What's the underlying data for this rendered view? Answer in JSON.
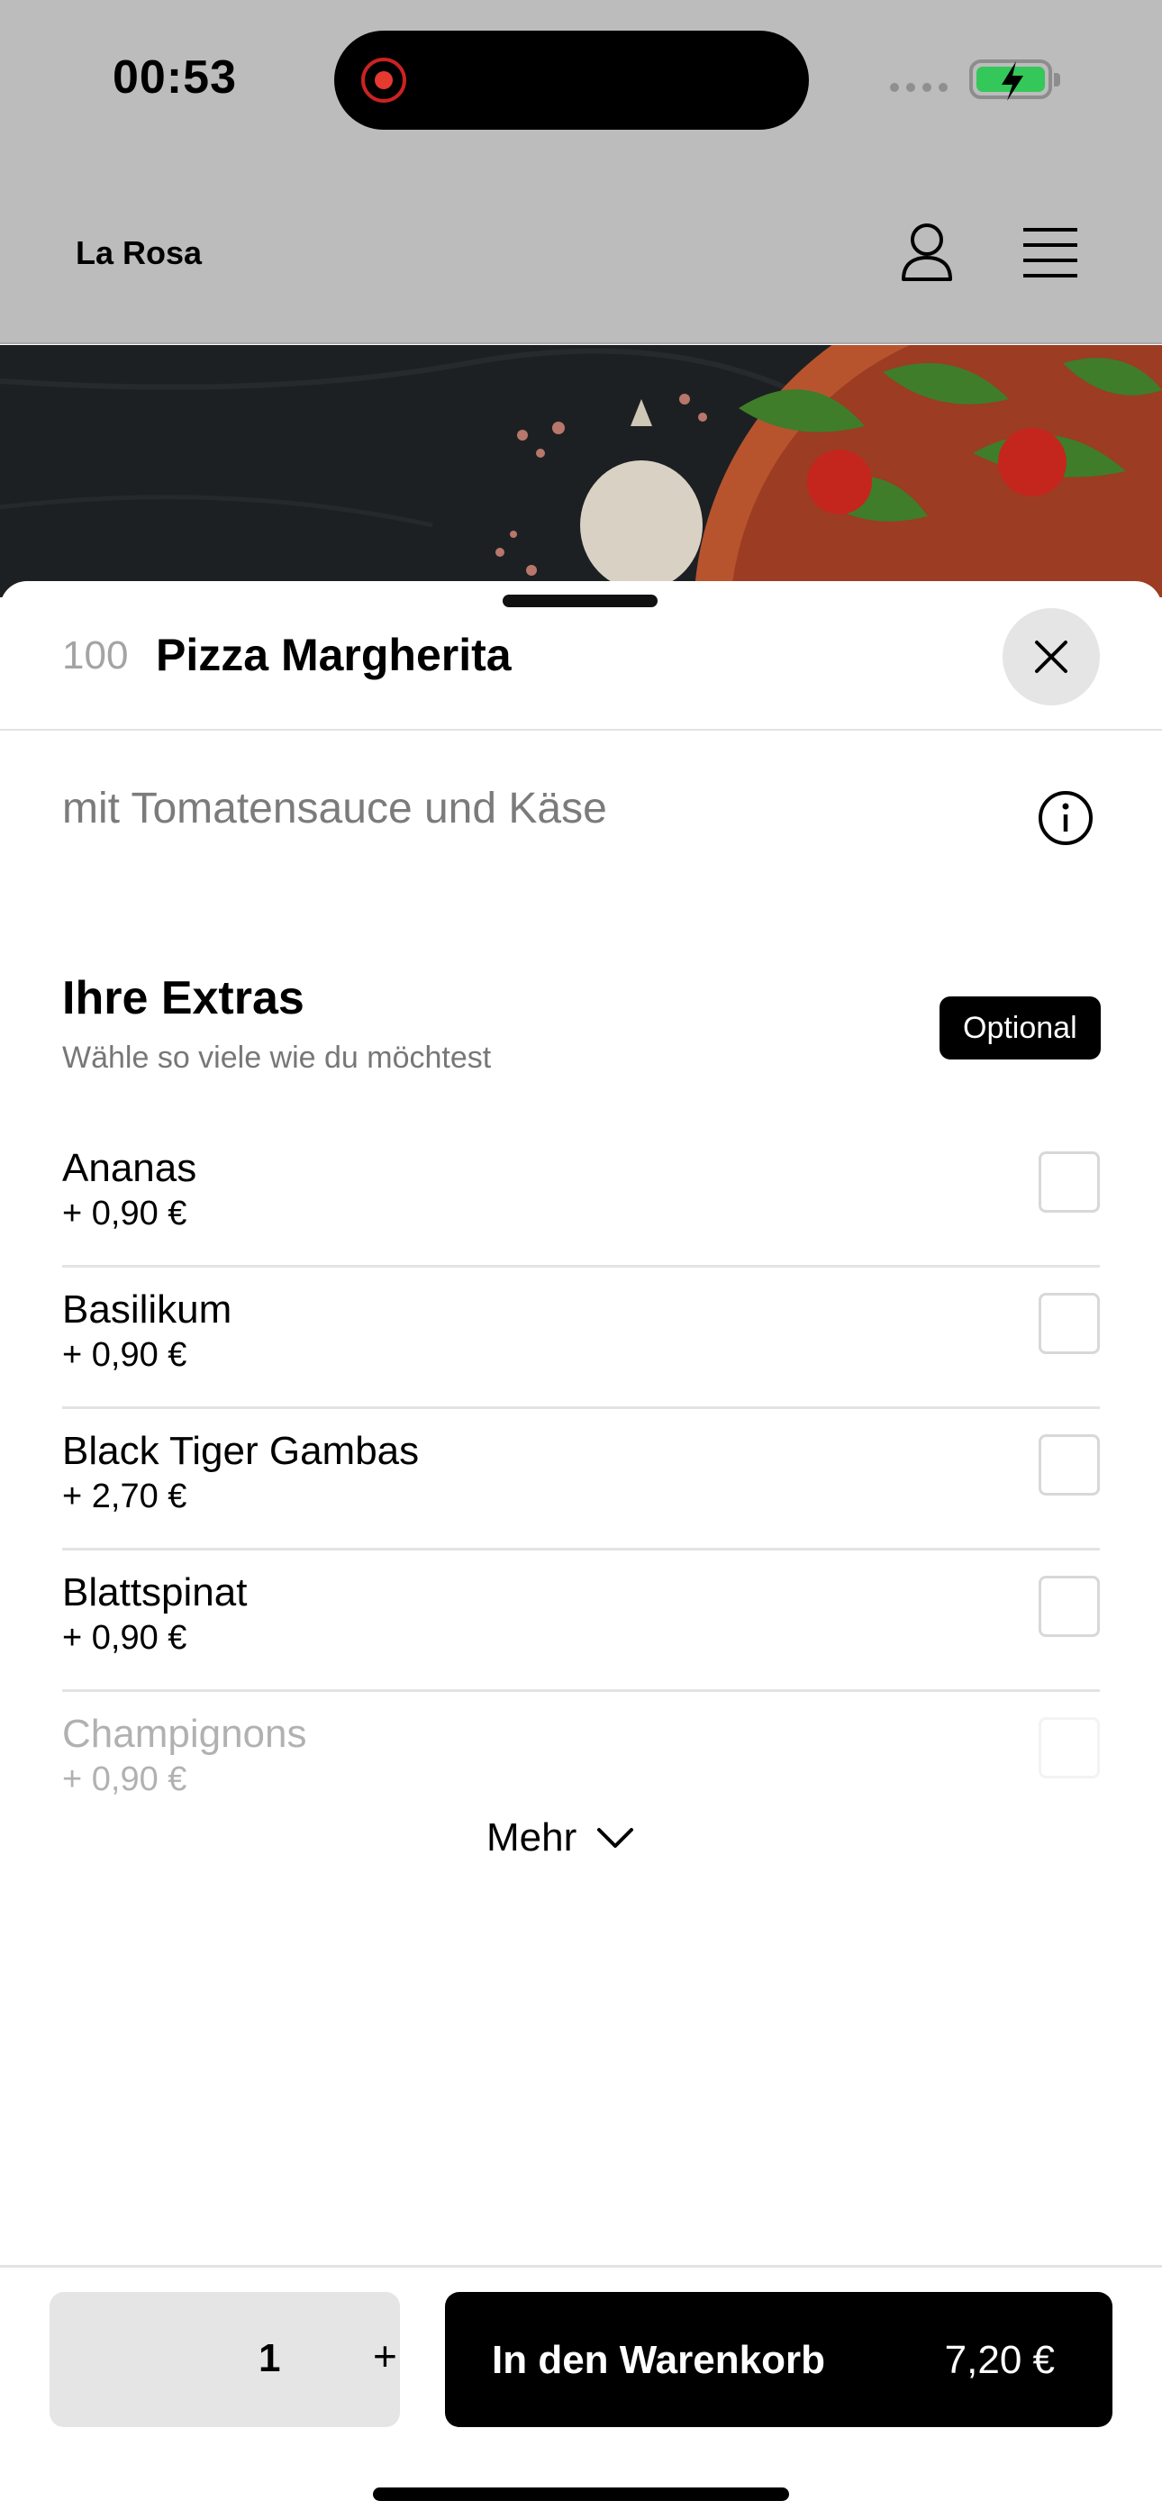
{
  "status_bar": {
    "time": "00:53",
    "recording_indicator_color": "#e53a2f",
    "battery_color": "#34c759"
  },
  "app_bar": {
    "brand": "La Rosa",
    "icons": [
      "user-icon",
      "menu-icon"
    ]
  },
  "product": {
    "number": "100",
    "name": "Pizza Margherita",
    "description": "mit Tomatensauce und Käse"
  },
  "extras": {
    "title": "Ihre Extras",
    "subtitle": "Wähle so viele wie du möchtest",
    "badge": "Optional",
    "items": [
      {
        "name": "Ananas",
        "price": "+ 0,90 €",
        "checked": false
      },
      {
        "name": "Basilikum",
        "price": "+ 0,90 €",
        "checked": false
      },
      {
        "name": "Black Tiger Gambas",
        "price": "+ 2,70 €",
        "checked": false
      },
      {
        "name": "Blattspinat",
        "price": "+ 0,90 €",
        "checked": false
      },
      {
        "name": "Champignons",
        "price": "+ 0,90 €",
        "checked": false
      }
    ],
    "more_label": "Mehr"
  },
  "footer": {
    "quantity": "1",
    "plus": "+",
    "add_to_cart": "In den Warenkorb",
    "total": "7,20 €"
  }
}
